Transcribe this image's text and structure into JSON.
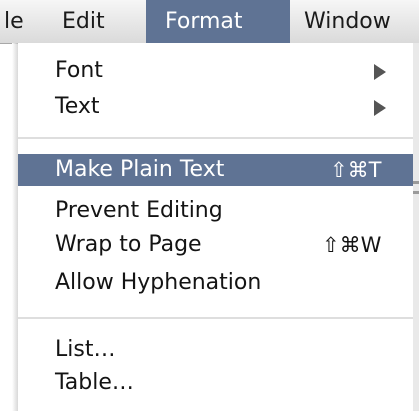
{
  "menubar": {
    "items": [
      {
        "label": "le"
      },
      {
        "label": "Edit"
      },
      {
        "label": "Format"
      },
      {
        "label": "Window"
      }
    ]
  },
  "format_menu": {
    "font": {
      "label": "Font"
    },
    "text": {
      "label": "Text"
    },
    "make_plain_text": {
      "label": "Make Plain Text",
      "shortcut": "⇧⌘T"
    },
    "prevent_editing": {
      "label": "Prevent Editing"
    },
    "wrap_to_page": {
      "label": "Wrap to Page",
      "shortcut": "⇧⌘W"
    },
    "allow_hyphenation": {
      "label": "Allow Hyphenation"
    },
    "list": {
      "label": "List…"
    },
    "table": {
      "label": "Table…"
    }
  },
  "colors": {
    "highlight": "#5f7394",
    "menubar": "#e6e6e6",
    "menu_background": "#ffffff"
  },
  "icons": {
    "submenu": "triangle-right"
  }
}
